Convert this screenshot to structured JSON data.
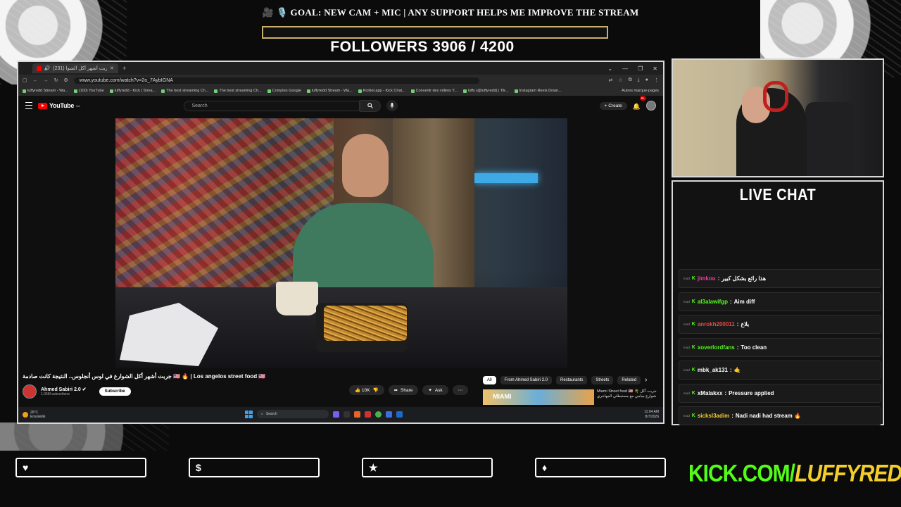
{
  "goal": {
    "text": "🎥 🎙️ GOAL: NEW CAM + MIC | ANY SUPPORT HELPS ME IMPROVE THE STREAM",
    "progress": 0,
    "followers_label": "FOLLOWERS 3906 / 4200",
    "followers_current": 3906,
    "followers_target": 4200
  },
  "browser": {
    "tab_title": "(231) جربت أشهر أكل الشوا",
    "url": "www.youtube.com/watch?v=2o_7AybIGNA",
    "bookmarks": [
      "luffyredd Stream - Wa...",
      "(100) YouTube",
      "luffyredd - Kick | Strea...",
      "The best streaming Ch...",
      "The best streaming Ch...",
      "Comptes Google",
      "luffyredd Stream - Wa...",
      "Kicklet.app - Kick Chat...",
      "Convertir des vidéos Y...",
      "luffy (@luffyredd) | Tik...",
      "Instagram Reels Down..."
    ],
    "bookmarks_more": "Autres marque-pages"
  },
  "youtube": {
    "logo": "YouTube",
    "logo_country": "MA",
    "search_placeholder": "Search",
    "create_label": "Create",
    "notif_count": "9+",
    "video_title": "جربت أشهر أكل الشوارع في لوس أنجلوس.. النتيجة كانت صادمة 🇺🇸 🔥 | Los angelos street food 🇺🇸",
    "channel_name": "Ahmed Sabiri 2.0",
    "subscribers": "1.05M subscribers",
    "subscribe_label": "Subscribe",
    "likes": "10K",
    "share_label": "Share",
    "ask_label": "Ask",
    "chips": [
      "All",
      "From Ahmed Sabiri 2.0",
      "Restaurants",
      "Streets",
      "Related"
    ],
    "rec_thumb_text": "MIAMI",
    "rec_title": "Miami Street food 🇺🇸 🌴 جربت أكل شوارع ميامي مع مستيطلي المهاجري"
  },
  "taskbar": {
    "temp": "26°C",
    "weather": "Ensoleillé",
    "search": "Search",
    "time": "11:04 AM",
    "date": "8/7/2026"
  },
  "chat": {
    "title": "LIVE CHAT",
    "messages": [
      {
        "user": "jimkou",
        "text": "هذا رائع بشكل كبير",
        "color": "#e0409b"
      },
      {
        "user": "al3alawifgp",
        "text": "Aim diff",
        "color": "#53fc18"
      },
      {
        "user": "anrokh200011",
        "text": "بلاع",
        "color": "#e54848"
      },
      {
        "user": "xoverlordfans",
        "text": "Too clean",
        "color": "#53fc18"
      },
      {
        "user": "mbk_ak131",
        "text": "🤙",
        "color": "#ffffff"
      },
      {
        "user": "xMalakxx",
        "text": "Pressure applied",
        "color": "#ffffff"
      },
      {
        "user": "sicksl3adim",
        "text": "Nadi nadi had stream 🔥",
        "color": "#f3ce2a"
      }
    ]
  },
  "social_icons": [
    "heart-icon",
    "dollar-icon",
    "star-icon",
    "diamond-icon"
  ],
  "kick": {
    "prefix": "KICK.COM/",
    "name": "LUFFYREDD"
  },
  "colors": {
    "kick_green": "#53fc18",
    "goal_gold": "#d9b64a",
    "yt_red": "#ff0000"
  }
}
